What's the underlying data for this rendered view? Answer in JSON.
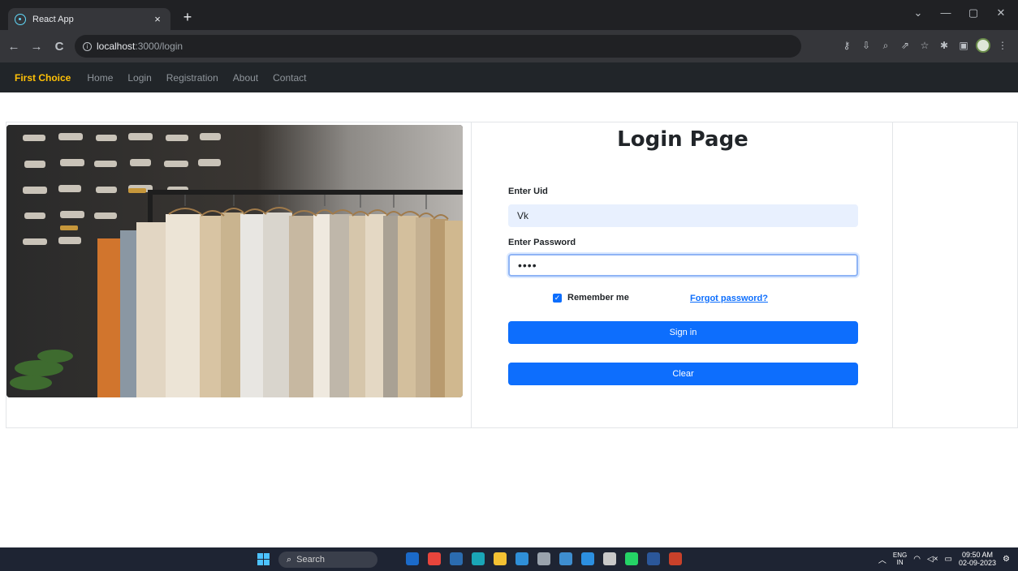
{
  "browser": {
    "tab_title": "React App",
    "tab_close": "×",
    "new_tab": "+",
    "url_host": "localhost",
    "url_path": ":3000/login",
    "window_controls": [
      "⌄",
      "—",
      "▢",
      "✕"
    ],
    "nav": {
      "back": "←",
      "forward": "→",
      "reload": "C"
    }
  },
  "navbar": {
    "brand": "First Choice",
    "links": [
      "Home",
      "Login",
      "Registration",
      "About",
      "Contact"
    ]
  },
  "login": {
    "title": "Login Page",
    "uid_label": "Enter Uid",
    "uid_value": "Vk",
    "password_label": "Enter Password",
    "password_value": "••••",
    "remember_label": "Remember me",
    "forgot_label": "Forgot password?",
    "signin_label": "Sign in",
    "clear_label": "Clear"
  },
  "taskbar": {
    "search_label": "Search",
    "lang_top": "ENG",
    "lang_bottom": "IN",
    "time": "09:50 AM",
    "date": "02-09-2023",
    "apps": [
      {
        "name": "bing-app-icon",
        "color": "#1b6ac9"
      },
      {
        "name": "chrome-app-icon",
        "color": "#e8453c"
      },
      {
        "name": "store-app-icon",
        "color": "#2b6cb0"
      },
      {
        "name": "edge-app-icon",
        "color": "#1aa6b7"
      },
      {
        "name": "explorer-app-icon",
        "color": "#f3c133"
      },
      {
        "name": "l-app-icon",
        "color": "#2f8fd8"
      },
      {
        "name": "settings-app-icon",
        "color": "#9aa3ad"
      },
      {
        "name": "monitor-app-icon",
        "color": "#3e8ed0"
      },
      {
        "name": "vscode-app-icon",
        "color": "#2c8fe0"
      },
      {
        "name": "gear-app-icon",
        "color": "#c9c9c9"
      },
      {
        "name": "whatsapp-app-icon",
        "color": "#25d366"
      },
      {
        "name": "word-app-icon",
        "color": "#2b579a"
      },
      {
        "name": "presentation-app-icon",
        "color": "#c9412a"
      }
    ]
  },
  "colors": {
    "primary": "#0d6efd",
    "brand": "#ffc107",
    "navbar_bg": "#212529"
  }
}
